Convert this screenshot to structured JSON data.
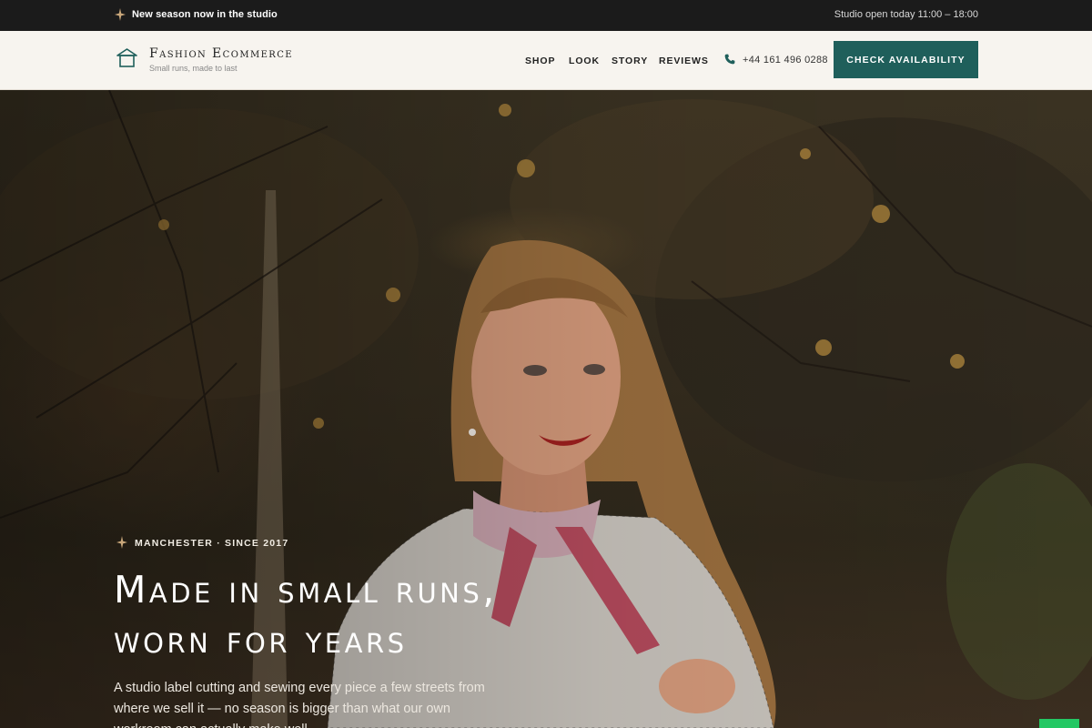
{
  "announcement": {
    "promo": "New season now in the studio",
    "hours": "Studio open today 11:00 – 18:00",
    "spark_icon": "sparkle-icon"
  },
  "header": {
    "brand_name": "Fashion Ecommerce",
    "brand_tagline": "Small runs, made to last",
    "logo_icon": "hanger-logo-icon",
    "nav": [
      "SHOP",
      "LOOK",
      "STORY",
      "REVIEWS"
    ],
    "phone": "+44 161 496 0288",
    "phone_icon": "phone-icon",
    "cta_label": "CHECK AVAILABILITY"
  },
  "hero": {
    "eyebrow": "MANCHESTER · SINCE 2017",
    "headline_line1": "Made in small runs,",
    "headline_line2": "worn for years",
    "subtext": "A studio label cutting and sewing every piece a few streets from where we sell it — no season is bigger than what our own workroom can actually make well."
  },
  "colors": {
    "accent": "#1f5f5b",
    "topbar": "#1b1b1b",
    "header_bg": "#f7f4ef",
    "chat_widget": "#24c864"
  }
}
